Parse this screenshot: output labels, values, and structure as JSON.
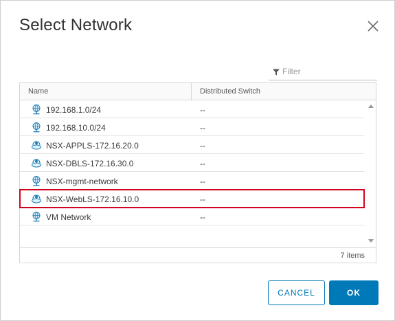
{
  "dialog": {
    "title": "Select Network"
  },
  "filter": {
    "placeholder": "Filter"
  },
  "table": {
    "columns": [
      "Name",
      "Distributed Switch"
    ],
    "rows": [
      {
        "name": "192.168.1.0/24",
        "switch": "--",
        "icon": "vm-network-icon"
      },
      {
        "name": "192.168.10.0/24",
        "switch": "--",
        "icon": "vm-network-icon"
      },
      {
        "name": "NSX-APPLS-172.16.20.0",
        "switch": "--",
        "icon": "logical-switch-icon"
      },
      {
        "name": "NSX-DBLS-172.16.30.0",
        "switch": "--",
        "icon": "logical-switch-icon"
      },
      {
        "name": "NSX-mgmt-network",
        "switch": "--",
        "icon": "vm-network-icon"
      },
      {
        "name": "NSX-WebLS-172.16.10.0",
        "switch": "--",
        "icon": "logical-switch-icon"
      },
      {
        "name": "VM Network",
        "switch": "--",
        "icon": "vm-network-icon"
      }
    ],
    "item_count": "7 items"
  },
  "buttons": {
    "cancel": "CANCEL",
    "ok": "OK"
  },
  "colors": {
    "accent": "#0079b8",
    "selection_highlight": "#d0021b"
  }
}
